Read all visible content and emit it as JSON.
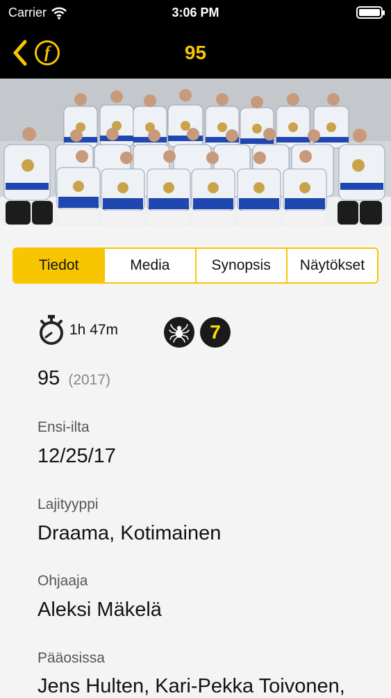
{
  "status_bar": {
    "carrier": "Carrier",
    "time": "3:06 PM"
  },
  "nav": {
    "title": "95",
    "back_icon": "chevron-left-icon",
    "info_icon": "f-circle-icon",
    "accent_color": "#f7c600"
  },
  "tabs": [
    {
      "label": "Tiedot",
      "active": true
    },
    {
      "label": "Media",
      "active": false
    },
    {
      "label": "Synopsis",
      "active": false
    },
    {
      "label": "Näytökset",
      "active": false
    }
  ],
  "details": {
    "duration": "1h 47m",
    "age_rating": "7",
    "content_warning_icon": "spider-icon",
    "movie_title": "95",
    "year": "(2017)",
    "premiere_label": "Ensi-ilta",
    "premiere_value": "12/25/17",
    "genre_label": "Lajityyppi",
    "genre_value": "Draama, Kotimainen",
    "director_label": "Ohjaaja",
    "director_value": "Aleksi Mäkelä",
    "cast_label": "Pääosissa",
    "cast_value": "Jens Hulten, Kari-Pekka Toivonen,"
  }
}
